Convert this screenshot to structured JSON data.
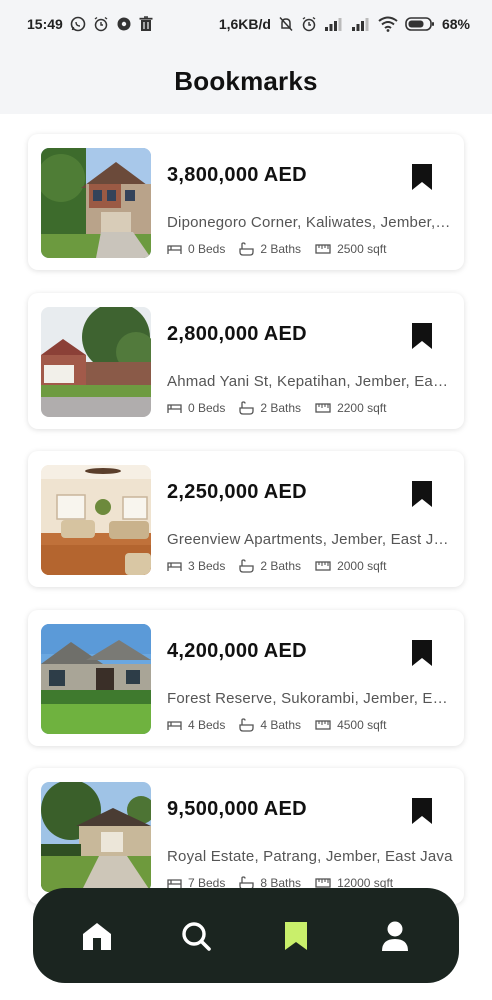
{
  "status_bar": {
    "time": "15:49",
    "network_speed": "1,6KB/d",
    "battery": "68%",
    "icons_left": [
      "whatsapp-icon",
      "alarm-icon",
      "chat-icon",
      "trash-icon"
    ],
    "icons_right": [
      "mute-icon",
      "alarm-icon",
      "signal-icon",
      "signal-icon",
      "wifi-icon",
      "battery-icon"
    ]
  },
  "header": {
    "title": "Bookmarks"
  },
  "listings": [
    {
      "price": "3,800,000 AED",
      "address": "Diponegoro Corner, Kaliwates, Jember, East Java",
      "beds": "0 Beds",
      "baths": "2 Baths",
      "area": "2500 sqft",
      "image": "two-story-house"
    },
    {
      "price": "2,800,000 AED",
      "address": "Ahmad Yani St, Kepatihan, Jember, East Java",
      "beds": "0 Beds",
      "baths": "2 Baths",
      "area": "2200 sqft",
      "image": "brick-house-with-tree"
    },
    {
      "price": "2,250,000 AED",
      "address": "Greenview Apartments, Jember, East Java",
      "beds": "3 Beds",
      "baths": "2 Baths",
      "area": "2000 sqft",
      "image": "living-room-interior"
    },
    {
      "price": "4,200,000 AED",
      "address": "Forest Reserve, Sukorambi, Jember, East Java",
      "beds": "4 Beds",
      "baths": "4 Baths",
      "area": "4500 sqft",
      "image": "stone-house-with-lawn"
    },
    {
      "price": "9,500,000 AED",
      "address": "Royal Estate, Patrang, Jember, East Java",
      "beds": "7 Beds",
      "baths": "8 Baths",
      "area": "12000 sqft",
      "image": "house-with-driveway"
    }
  ],
  "bottom_nav": {
    "items": [
      {
        "icon": "home-icon",
        "active": false
      },
      {
        "icon": "search-icon",
        "active": false
      },
      {
        "icon": "bookmark-icon",
        "active": true
      },
      {
        "icon": "profile-icon",
        "active": false
      }
    ]
  },
  "colors": {
    "accent": "#c9ef6b",
    "nav_background": "#1b2520",
    "header_background": "#f4f5f7",
    "bookmark": "#111111"
  }
}
